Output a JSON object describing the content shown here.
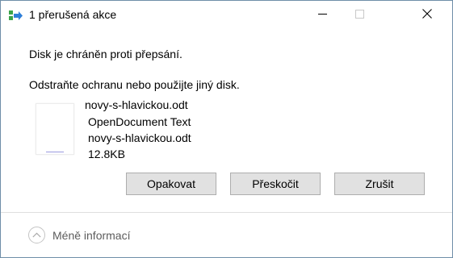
{
  "window": {
    "title": "1 přerušená akce",
    "controls": {
      "minimize": "minimize-icon",
      "maximize": "maximize-icon",
      "close": "close-icon"
    }
  },
  "message": {
    "line1": "Disk je chráněn proti přepsání.",
    "line2": "Odstraňte ochranu nebo použijte jiný disk."
  },
  "file": {
    "name": "novy-s-hlavickou.odt",
    "type": "OpenDocument Text",
    "name_repeat": "novy-s-hlavickou.odt",
    "size": "12.8KB"
  },
  "buttons": {
    "retry": "Opakovat",
    "skip": "Přeskočit",
    "cancel": "Zrušit"
  },
  "footer": {
    "toggle_label": "Méně informací",
    "toggle_icon": "chevron-up-icon"
  },
  "colors": {
    "button_bg": "#e1e1e1",
    "button_border": "#adadad",
    "footer_text": "#5c5c5c"
  }
}
